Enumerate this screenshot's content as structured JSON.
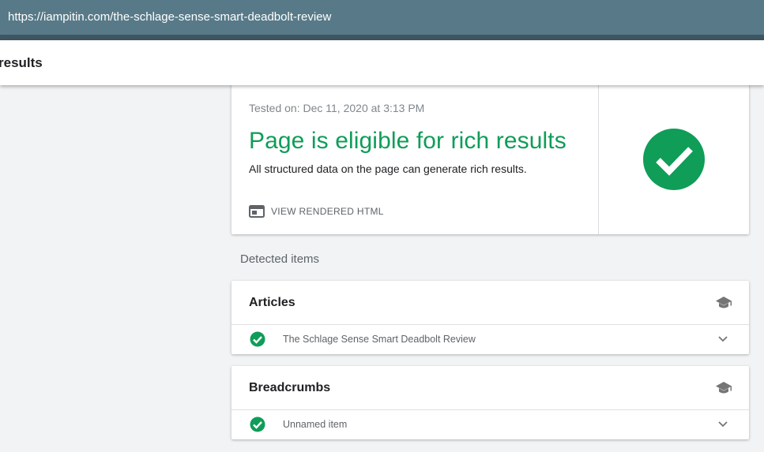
{
  "browser": {
    "url": "https://iampitin.com/the-schlage-sense-smart-deadbolt-review"
  },
  "header": {
    "title": "results"
  },
  "summary": {
    "tested_on": "Tested on: Dec 11, 2020 at 3:13 PM",
    "status_title": "Page is eligible for rich results",
    "status_description": "All structured data on the page can generate rich results.",
    "view_html_label": "VIEW RENDERED HTML",
    "status_icon": "check-circle-icon"
  },
  "detected": {
    "heading": "Detected items",
    "groups": [
      {
        "title": "Articles",
        "icon": "graduation-cap-icon",
        "items": [
          {
            "label": "The Schlage Sense Smart Deadbolt Review",
            "status_icon": "check-circle-icon"
          }
        ]
      },
      {
        "title": "Breadcrumbs",
        "icon": "graduation-cap-icon",
        "items": [
          {
            "label": "Unnamed item",
            "status_icon": "check-circle-icon"
          }
        ]
      }
    ]
  },
  "colors": {
    "success": "#0f9d58",
    "address_bar": "#587a88",
    "background": "#f1f3f4"
  }
}
